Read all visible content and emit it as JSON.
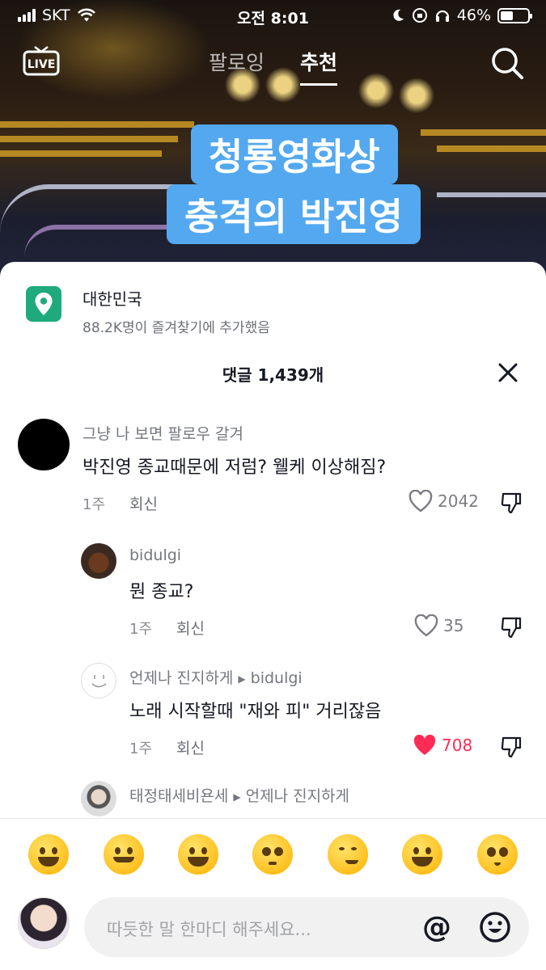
{
  "status_bar": {
    "carrier": "SKT",
    "time": "오전 8:01",
    "battery": "46%",
    "battery_level": 0.46
  },
  "nav": {
    "live_label": "LIVE",
    "tabs": [
      {
        "label": "팔로잉",
        "active": false
      },
      {
        "label": "추천",
        "active": true
      }
    ]
  },
  "video": {
    "caption_line1": "청룡영화상",
    "caption_line2": "충격의 박진영",
    "caption_color": "#54a8f0"
  },
  "location": {
    "name": "대한민국",
    "sub": "88.2K명이 즐겨찾기에 추가했음",
    "color": "#1faa7d"
  },
  "comments_header": {
    "title": "댓글 1,439개"
  },
  "comments": [
    {
      "user": "그냥 나 보면 팔로우 갈겨",
      "text": "박진영 종교때문에 저럼? 웰케 이상해짐?",
      "time": "1주",
      "reply": "회신",
      "likes": "2042",
      "liked": false
    },
    {
      "user": "bidulgi",
      "text": "뭔 종교?",
      "time": "1주",
      "reply": "회신",
      "likes": "35",
      "liked": false
    },
    {
      "user": "언제나 진지하게",
      "reply_to": "bidulgi",
      "text": "노래 시작할때 \"재와 피\" 거리잖음",
      "time": "1주",
      "reply": "회신",
      "likes": "708",
      "liked": true
    },
    {
      "user": "태정태세비욘세",
      "reply_to": "언제나 진지하게"
    }
  ],
  "emoji_bar": [
    "grin",
    "smiling-hearts",
    "tears-of-joy",
    "flushed",
    "smirk",
    "sweat-smile",
    "pleading"
  ],
  "input": {
    "placeholder": "따듯한 말 한마디 해주세요...",
    "at_symbol": "@"
  },
  "colors": {
    "like_active": "#fe2c55",
    "text_primary": "#161823",
    "text_secondary": "#757780"
  }
}
